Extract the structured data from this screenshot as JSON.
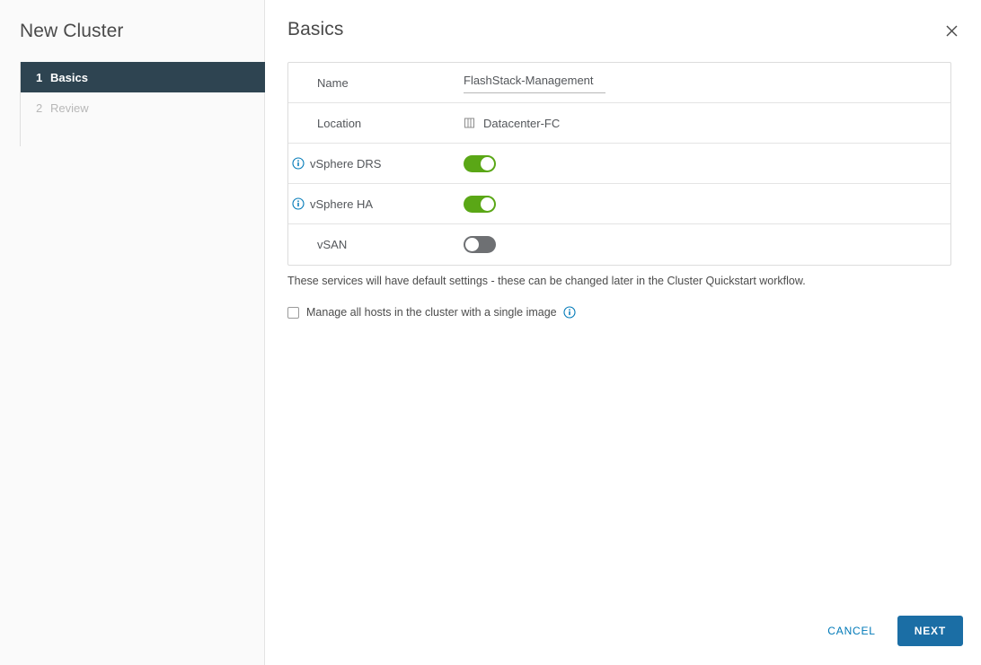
{
  "wizard": {
    "title": "New Cluster",
    "steps": [
      {
        "num": "1",
        "label": "Basics",
        "state": "active"
      },
      {
        "num": "2",
        "label": "Review",
        "state": "inactive"
      }
    ]
  },
  "header": {
    "page_title": "Basics",
    "close_icon": "close-icon"
  },
  "form": {
    "rows": [
      {
        "label": "Name",
        "value": "FlashStack-Management",
        "type": "text-input"
      },
      {
        "label": "Location",
        "value": "Datacenter-FC",
        "type": "static",
        "icon": "datacenter-icon"
      },
      {
        "label": "vSphere DRS",
        "value": "on",
        "type": "toggle",
        "icon": "info-icon"
      },
      {
        "label": "vSphere HA",
        "value": "on",
        "type": "toggle",
        "icon": "info-icon"
      },
      {
        "label": "vSAN",
        "value": "off",
        "type": "toggle"
      }
    ],
    "helper_text": "These services will have default settings - these can be changed later in the Cluster Quickstart workflow.",
    "checkbox": {
      "label": "Manage all hosts in the cluster with a single image",
      "checked": false,
      "icon": "info-icon"
    }
  },
  "footer": {
    "cancel_label": "CANCEL",
    "next_label": "NEXT"
  },
  "colors": {
    "active_step_bg": "#2e4451",
    "toggle_on": "#5aa716",
    "toggle_off": "#6e7073",
    "primary_button": "#1b6ea5",
    "link_blue": "#0079b8",
    "info_icon_blue": "#0079b8"
  }
}
